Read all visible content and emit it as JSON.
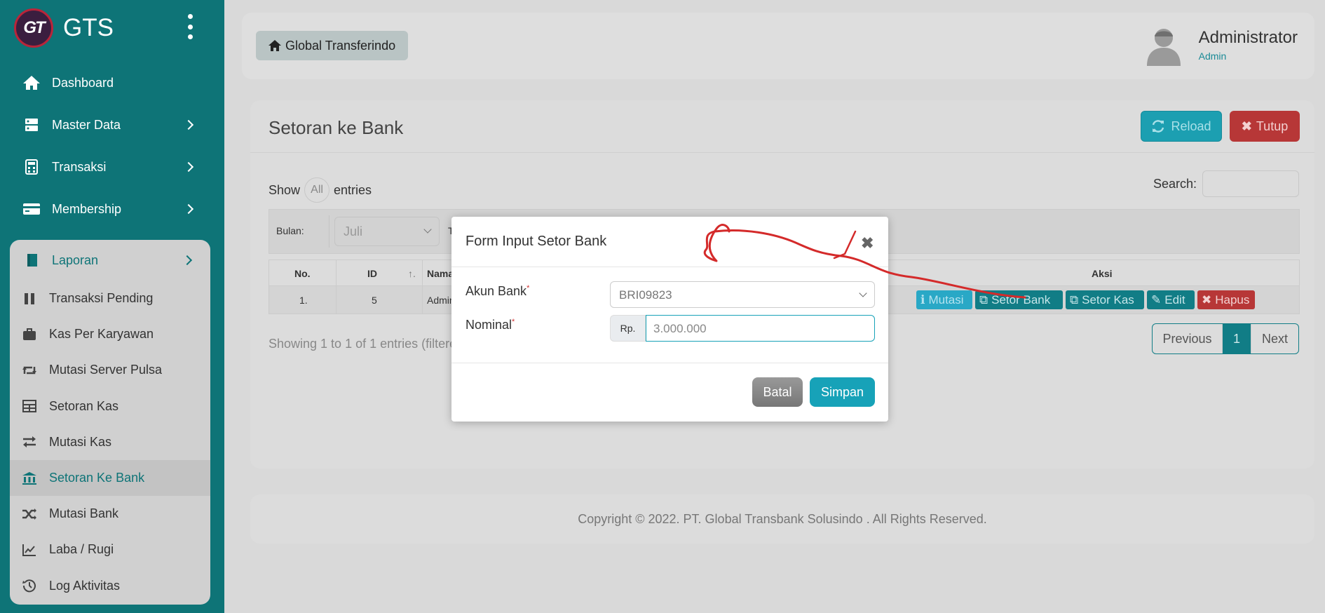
{
  "brand": {
    "logo_text": "GT",
    "name": "GTS"
  },
  "sidebar": {
    "top_items": [
      {
        "label": "Dashboard"
      },
      {
        "label": "Master Data"
      },
      {
        "label": "Transaksi"
      },
      {
        "label": "Membership"
      }
    ],
    "group": {
      "label": "Laporan",
      "items": [
        {
          "label": "Transaksi Pending"
        },
        {
          "label": "Kas Per Karyawan"
        },
        {
          "label": "Mutasi Server Pulsa"
        },
        {
          "label": "Setoran Kas"
        },
        {
          "label": "Mutasi Kas"
        },
        {
          "label": "Setoran Ke Bank"
        },
        {
          "label": "Mutasi Bank"
        },
        {
          "label": "Laba / Rugi"
        },
        {
          "label": "Log Aktivitas"
        }
      ]
    }
  },
  "header": {
    "breadcrumb": "Global Transferindo",
    "user_name": "Administrator",
    "user_role": "Admin"
  },
  "page": {
    "title": "Setoran ke Bank",
    "reload_label": "Reload",
    "tutup_label": "Tutup",
    "show_label": "Show",
    "show_value": "All",
    "entries_label": "entries",
    "search_label": "Search:",
    "filter": {
      "bulan_label": "Bulan:",
      "bulan_value": "Juli",
      "tahun_label_partial": "T"
    },
    "table": {
      "headers": {
        "no": "No.",
        "id": "ID",
        "nama": "Nama",
        "aksi": "Aksi"
      },
      "rows": [
        {
          "no": "1.",
          "id": "5",
          "nama": "Admin"
        }
      ],
      "actions": {
        "mutasi": "Mutasi",
        "setor_bank": "Setor Bank",
        "setor_kas": "Setor Kas",
        "edit": "Edit",
        "hapus": "Hapus"
      }
    },
    "info": "Showing 1 to 1 of 1 entries (filtere",
    "pagination": {
      "previous": "Previous",
      "current": "1",
      "next": "Next"
    }
  },
  "footer": {
    "text": "Copyright © 2022. PT. Global Transbank Solusindo . All Rights Reserved."
  },
  "modal": {
    "title": "Form Input Setor Bank",
    "akun_label": "Akun Bank",
    "akun_value": "BRI09823",
    "nominal_label": "Nominal",
    "required_mark": "*",
    "currency_addon": "Rp.",
    "nominal_placeholder": "3.000.000",
    "batal_label": "Batal",
    "simpan_label": "Simpan"
  },
  "colors": {
    "sidebar": "#0e7477",
    "accent": "#17a2b8",
    "danger": "#b73737",
    "annotation": "#d42a2a"
  }
}
